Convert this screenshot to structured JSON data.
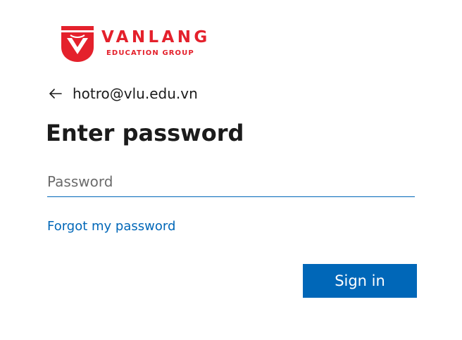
{
  "brand": {
    "name": "VANLANG",
    "subtitle": "EDUCATION GROUP",
    "color": "#e4212c"
  },
  "identity": {
    "back_icon": "arrow-left-icon",
    "email": "hotro@vlu.edu.vn"
  },
  "title": "Enter password",
  "password_field": {
    "placeholder": "Password",
    "value": ""
  },
  "forgot_link": "Forgot my password",
  "sign_in_label": "Sign in",
  "colors": {
    "accent": "#0067b8",
    "text": "#1b1b1b",
    "placeholder": "#6b6b6b"
  }
}
